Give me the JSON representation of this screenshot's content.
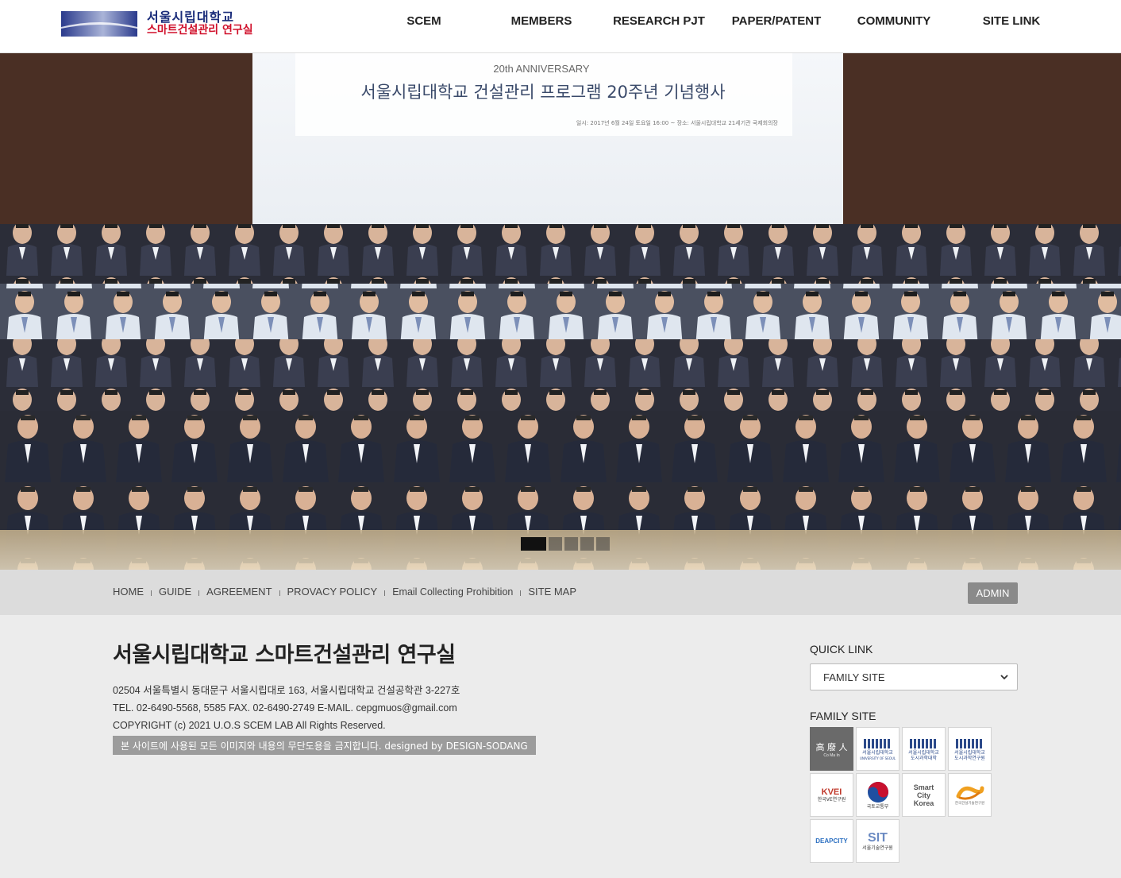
{
  "header": {
    "logo_line1": "서울시립대학교",
    "logo_line2": "스마트건설관리 연구실",
    "nav": [
      "SCEM",
      "MEMBERS",
      "RESEARCH PJT",
      "PAPER/PATENT",
      "COMMUNITY",
      "SITE LINK"
    ]
  },
  "hero": {
    "banner_anniv": "20th ANNIVERSARY",
    "banner_title": "서울시립대학교 건설관리 프로그램 20주년 기념행사",
    "banner_sub": "일시: 2017년 6월 24일 토요일 16:00 ~     장소: 서울시립대학교 21세기관 국제회의장",
    "slides_total": 5,
    "slide_active": 1
  },
  "footbar": {
    "links": [
      "HOME",
      "GUIDE",
      "AGREEMENT",
      "PROVACY POLICY",
      "Email Collecting Prohibition",
      "SITE MAP"
    ],
    "admin": "ADMIN"
  },
  "footer": {
    "title": "서울시립대학교 스마트건설관리 연구실",
    "address": "02504 서울특별시 동대문구 서울시립대로 163, 서울시립대학교 건설공학관 3-227호",
    "contact": "TEL. 02-6490-5568, 5585  FAX. 02-6490-2749  E-MAIL. cepgmuos@gmail.com",
    "copyright": "COPYRIGHT (c) 2021 U.O.S SCEM LAB All Rights Reserved.",
    "notice": "본 사이트에 사용된 모든 이미지와 내용의 무단도용을 금지합니다. designed by DESIGN-SODANG",
    "quick_link_label": "QUICK LINK",
    "quick_link_select": "FAMILY SITE",
    "family_site_label": "FAMILY SITE",
    "family_sites": [
      {
        "name": "cosmain-logo",
        "text": "高 廢 人",
        "sub": "Co Ma In"
      },
      {
        "name": "uos-logo",
        "text": "서울시립대학교",
        "sub": "UNIVERSITY OF SEOUL"
      },
      {
        "name": "uos-urban-college-logo",
        "text": "서울시립대학교",
        "sub": "도시과학대학"
      },
      {
        "name": "uos-urban-institute-logo",
        "text": "서울시립대학교",
        "sub": "도시과학연구원"
      },
      {
        "name": "kvei-logo",
        "text": "KVEI",
        "sub": "한국VE연구원"
      },
      {
        "name": "molit-logo",
        "text": "국토교통부",
        "sub": ""
      },
      {
        "name": "smart-city-korea-logo",
        "text": "Smart City Korea",
        "sub": ""
      },
      {
        "name": "kict-logo",
        "text": "",
        "sub": "한국건설기술연구원"
      },
      {
        "name": "deapcity-logo",
        "text": "DEAPCITY",
        "sub": ""
      },
      {
        "name": "sit-logo",
        "text": "SIT",
        "sub": "서울기술연구원"
      }
    ]
  }
}
